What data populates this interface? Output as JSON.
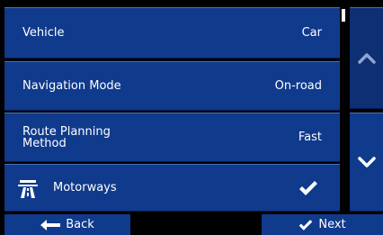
{
  "settings": {
    "vehicle": {
      "label": "Vehicle",
      "value": "Car"
    },
    "navigation_mode": {
      "label": "Navigation Mode",
      "value": "On-road"
    },
    "route_planning": {
      "label": "Route Planning Method",
      "value": "Fast"
    },
    "motorways": {
      "label": "Motorways",
      "enabled": true
    }
  },
  "footer": {
    "back_label": "Back",
    "next_label": "Next"
  },
  "colors": {
    "row_bg": "#103a8c",
    "screen_bg": "#000000",
    "text": "#ffffff"
  }
}
